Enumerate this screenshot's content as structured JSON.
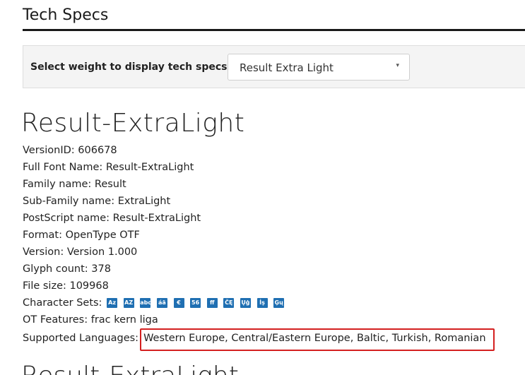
{
  "section": {
    "title": "Tech Specs"
  },
  "weight_selector": {
    "label": "Select weight to display tech specs:",
    "selected": "Result Extra Light",
    "caret": "▾"
  },
  "font": {
    "name": "Result-ExtraLight",
    "specs": [
      {
        "label": "VersionID:",
        "value": "606678"
      },
      {
        "label": "Full Font Name:",
        "value": "Result-ExtraLight"
      },
      {
        "label": "Family name:",
        "value": "Result"
      },
      {
        "label": "Sub-Family name:",
        "value": "ExtraLight"
      },
      {
        "label": "PostScript name:",
        "value": "Result-ExtraLight"
      },
      {
        "label": "Format:",
        "value": "OpenType OTF"
      },
      {
        "label": "Version:",
        "value": "Version 1.000"
      },
      {
        "label": "Glyph count:",
        "value": "378"
      },
      {
        "label": "File size:",
        "value": "109968"
      }
    ],
    "character_sets": {
      "label": "Character Sets:",
      "icons": [
        "Az",
        "AZ",
        "abc",
        "áä",
        "€",
        "56",
        "ff",
        "ČĘ",
        "Ųġ",
        "İş",
        "Ģų"
      ]
    },
    "ot_features": {
      "label": "OT Features:",
      "value": "frac kern liga"
    },
    "supported_languages": {
      "label": "Supported Languages:",
      "value": "Western Europe, Central/Eastern Europe, Baltic, Turkish, Romanian"
    }
  },
  "next_font": {
    "name": "Result-ExtraLight"
  },
  "colors": {
    "charset_icon_bg": "#1f6fb2",
    "highlight_border": "#d42020"
  }
}
